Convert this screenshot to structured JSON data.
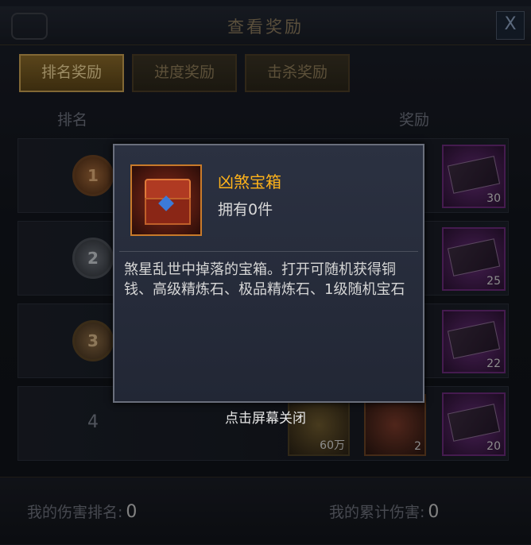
{
  "window": {
    "title": "查看奖励",
    "close_label": "X"
  },
  "tabs": [
    {
      "label": "排名奖励",
      "active": true
    },
    {
      "label": "进度奖励",
      "active": false
    },
    {
      "label": "击杀奖励",
      "active": false
    }
  ],
  "columns": {
    "rank": "排名",
    "reward": "奖励"
  },
  "rows": [
    {
      "rank": "1",
      "reward_count": "30"
    },
    {
      "rank": "2",
      "reward_count": "25"
    },
    {
      "rank": "3",
      "reward_count": "22"
    },
    {
      "rank": "4",
      "coin_count": "60万",
      "chest_count": "2",
      "reward_count": "20"
    }
  ],
  "footer": {
    "my_rank_label": "我的伤害排名:",
    "my_rank_value": "0",
    "total_damage_label": "我的累计伤害:",
    "total_damage_value": "0"
  },
  "tooltip": {
    "item_name": "凶煞宝箱",
    "owned": "拥有0件",
    "description": "煞星乱世中掉落的宝箱。打开可随机获得铜钱、高级精炼石、极品精炼石、1级随机宝石",
    "name_color": "#ffb31a"
  },
  "hint": "点击屏幕关闭"
}
